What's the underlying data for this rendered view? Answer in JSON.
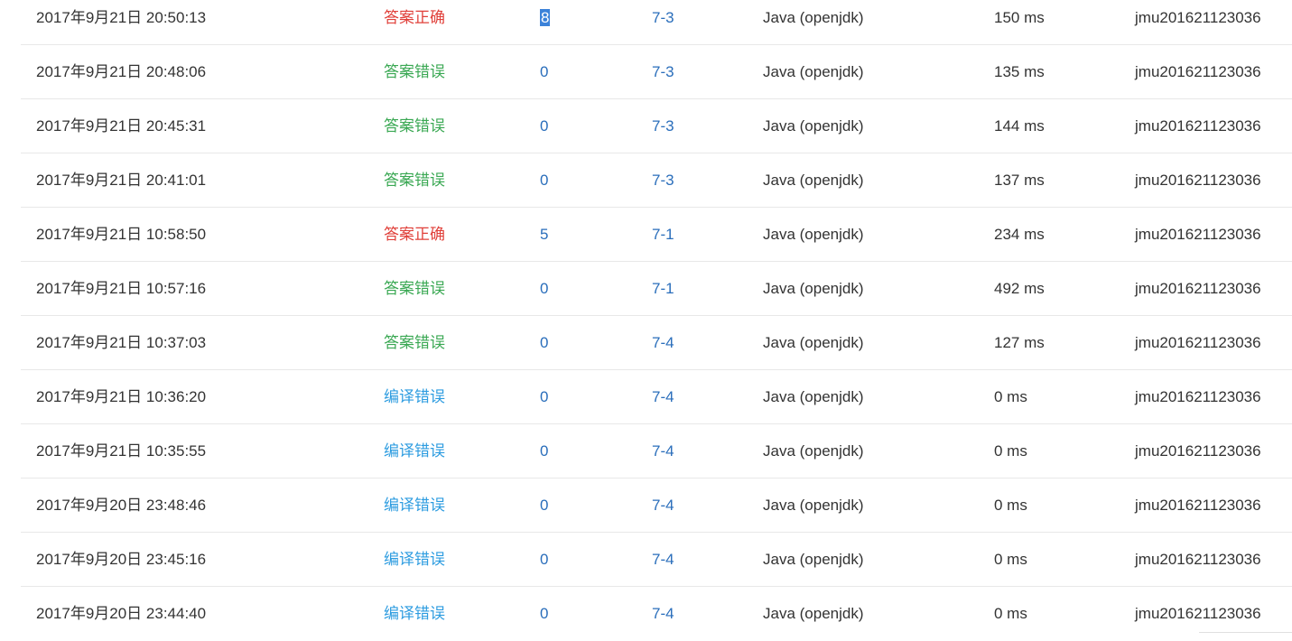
{
  "colors": {
    "correct": "#e0403a",
    "wrong": "#3aa853",
    "compile_error": "#2d9ce0",
    "link": "#2a6ebb"
  },
  "rows": [
    {
      "time": "2017年9月21日 20:50:13",
      "status": "答案正确",
      "status_type": "correct",
      "score": "8",
      "problem": "7-3",
      "language": "Java (openjdk)",
      "time_used": "150 ms",
      "user": "jmu201621123036"
    },
    {
      "time": "2017年9月21日 20:48:06",
      "status": "答案错误",
      "status_type": "wrong",
      "score": "0",
      "problem": "7-3",
      "language": "Java (openjdk)",
      "time_used": "135 ms",
      "user": "jmu201621123036"
    },
    {
      "time": "2017年9月21日 20:45:31",
      "status": "答案错误",
      "status_type": "wrong",
      "score": "0",
      "problem": "7-3",
      "language": "Java (openjdk)",
      "time_used": "144 ms",
      "user": "jmu201621123036"
    },
    {
      "time": "2017年9月21日 20:41:01",
      "status": "答案错误",
      "status_type": "wrong",
      "score": "0",
      "problem": "7-3",
      "language": "Java (openjdk)",
      "time_used": "137 ms",
      "user": "jmu201621123036"
    },
    {
      "time": "2017年9月21日 10:58:50",
      "status": "答案正确",
      "status_type": "correct",
      "score": "5",
      "problem": "7-1",
      "language": "Java (openjdk)",
      "time_used": "234 ms",
      "user": "jmu201621123036"
    },
    {
      "time": "2017年9月21日 10:57:16",
      "status": "答案错误",
      "status_type": "wrong",
      "score": "0",
      "problem": "7-1",
      "language": "Java (openjdk)",
      "time_used": "492 ms",
      "user": "jmu201621123036"
    },
    {
      "time": "2017年9月21日 10:37:03",
      "status": "答案错误",
      "status_type": "wrong",
      "score": "0",
      "problem": "7-4",
      "language": "Java (openjdk)",
      "time_used": "127 ms",
      "user": "jmu201621123036"
    },
    {
      "time": "2017年9月21日 10:36:20",
      "status": "编译错误",
      "status_type": "compile",
      "score": "0",
      "problem": "7-4",
      "language": "Java (openjdk)",
      "time_used": "0 ms",
      "user": "jmu201621123036"
    },
    {
      "time": "2017年9月21日 10:35:55",
      "status": "编译错误",
      "status_type": "compile",
      "score": "0",
      "problem": "7-4",
      "language": "Java (openjdk)",
      "time_used": "0 ms",
      "user": "jmu201621123036"
    },
    {
      "time": "2017年9月20日 23:48:46",
      "status": "编译错误",
      "status_type": "compile",
      "score": "0",
      "problem": "7-4",
      "language": "Java (openjdk)",
      "time_used": "0 ms",
      "user": "jmu201621123036"
    },
    {
      "time": "2017年9月20日 23:45:16",
      "status": "编译错误",
      "status_type": "compile",
      "score": "0",
      "problem": "7-4",
      "language": "Java (openjdk)",
      "time_used": "0 ms",
      "user": "jmu201621123036"
    },
    {
      "time": "2017年9月20日 23:44:40",
      "status": "编译错误",
      "status_type": "compile",
      "score": "0",
      "problem": "7-4",
      "language": "Java (openjdk)",
      "time_used": "0 ms",
      "user": "jmu201621123036"
    }
  ]
}
